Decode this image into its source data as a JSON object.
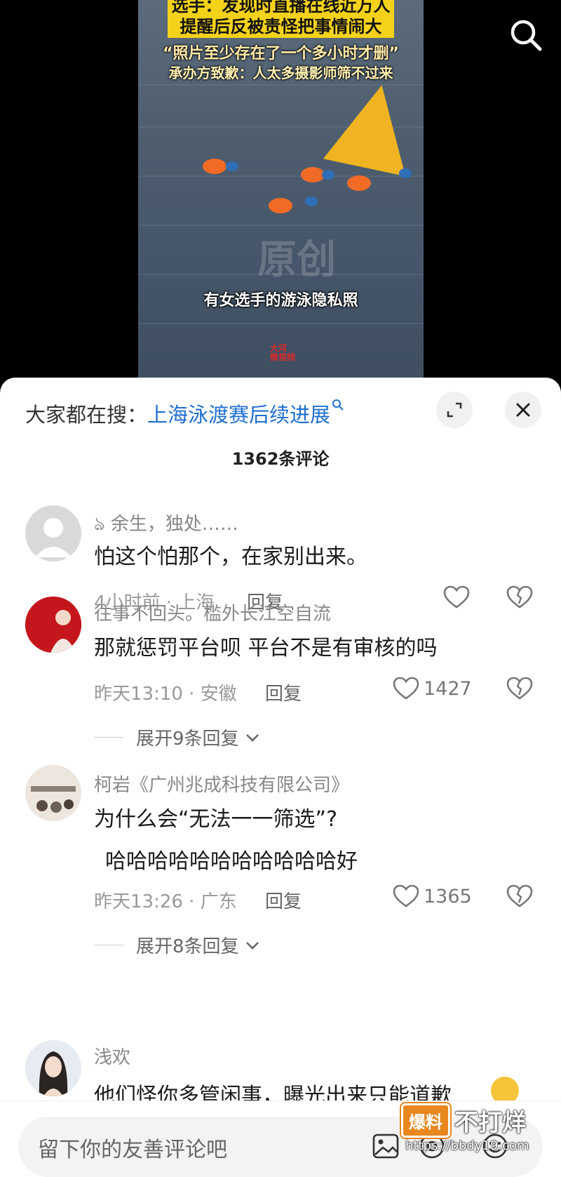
{
  "video": {
    "caption_yellow_1": "选手：发现时直播在线近万人",
    "caption_yellow_2": "提醒后反被责怪把事情闹大",
    "caption_white_1": "“照片至少存在了一个多小时才删”",
    "caption_white_2": "承办方致歉：人太多摄影师筛不过来",
    "subtitle": "有女选手的游泳隐私照",
    "watermark": "原创",
    "seal": "大河 微视频"
  },
  "sheet": {
    "hot_prefix": "大家都在搜：",
    "hot_link": "上海泳渡赛后续进展",
    "comment_count": "1362条评论"
  },
  "comments": [
    {
      "nick": "ঌ 余生，独处……",
      "text": "怕这个怕那个，在家别出来。",
      "time_loc": "4小时前 · 上海",
      "reply": "回复",
      "likes": ""
    },
    {
      "nick": "往事不回头。槛外长江空自流",
      "text": "那就惩罚平台呗 平台不是有审核的吗",
      "time_loc": "昨天13:10 · 安徽",
      "reply": "回复",
      "likes": "1427",
      "expand": "展开9条回复"
    },
    {
      "nick": "柯岩《广州兆成科技有限公司》",
      "text": "为什么会“无法一一筛选”?",
      "text2": "哈哈哈哈哈哈哈哈哈哈哈好",
      "time_loc": "昨天13:26 · 广东",
      "reply": "回复",
      "likes": "1365",
      "expand": "展开8条回复"
    },
    {
      "nick": "浅欢",
      "text": "他们怪你多管闲事，曝光出来只能道歉"
    }
  ],
  "input": {
    "placeholder": "留下你的友善评论吧"
  },
  "badge": {
    "box": "爆料",
    "text": "不打烊",
    "url": "https://bbdy19.com"
  }
}
